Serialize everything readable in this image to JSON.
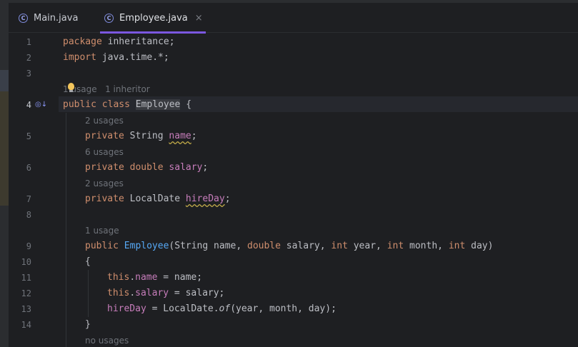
{
  "tabs": [
    {
      "label": "Main.java",
      "icon": "class-icon",
      "active": false
    },
    {
      "label": "Employee.java",
      "icon": "class-icon",
      "active": true,
      "close": "×"
    }
  ],
  "class_icon_glyph": "C",
  "colors": {
    "background": "#1e1f22",
    "keyword": "#cf8e6d",
    "field": "#c77dbb",
    "function": "#56a8f5",
    "text": "#bcbec4",
    "hint": "#6f737a",
    "accent": "#7b57e0"
  },
  "code": {
    "line_numbers": [
      "1",
      "2",
      "3",
      "4",
      "5",
      "6",
      "7",
      "8",
      "9",
      "10",
      "11",
      "12",
      "13",
      "14"
    ],
    "current_line": "4",
    "l1": {
      "kw": "package",
      "rest": " inheritance;"
    },
    "l2": {
      "kw": "import",
      "rest": " java.time.*;"
    },
    "hint_class": "1 usage   1 inheritor",
    "l4": {
      "kw1": "public",
      "kw2": "class",
      "name": "Employee",
      "rest": " {"
    },
    "hint_name": "2 usages",
    "l5": {
      "kw": "private",
      "type": " String ",
      "field": "name",
      "end": ";"
    },
    "hint_salary": "6 usages",
    "l6": {
      "kw1": "private",
      "kw2": "double",
      "field": "salary",
      "end": ";"
    },
    "hint_hireday": "2 usages",
    "l7": {
      "kw": "private",
      "type": " LocalDate ",
      "field": "hireDay",
      "end": ";"
    },
    "hint_ctor": "1 usage",
    "l9": {
      "kw": "public",
      "fn": "Employee",
      "p1": "(String name, ",
      "k1": "double",
      "p2": " salary, ",
      "k2": "int",
      "p3": " year, ",
      "k3": "int",
      "p4": " month, ",
      "k4": "int",
      "p5": " day)"
    },
    "l10": "{",
    "l11": {
      "this": "this",
      "dot": ".",
      "field": "name",
      "rest": " = name;"
    },
    "l12": {
      "this": "this",
      "dot": ".",
      "field": "salary",
      "rest": " = salary;"
    },
    "l13": {
      "field": "hireDay",
      "rest1": " = LocalDate.",
      "method": "of",
      "rest2": "(year, month, day);"
    },
    "l14": "}",
    "hint_next": "no usages"
  }
}
